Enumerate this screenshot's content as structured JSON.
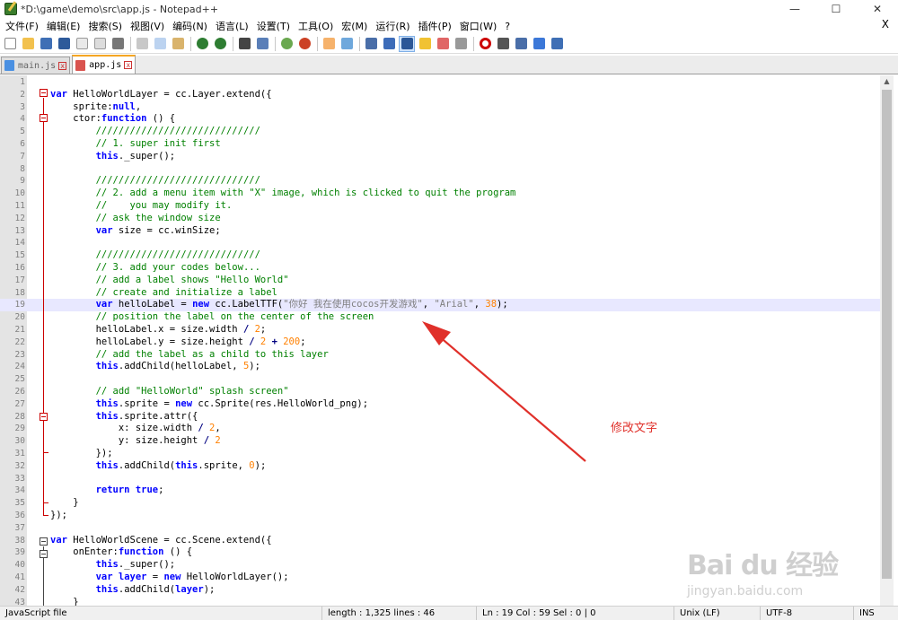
{
  "window": {
    "title": "*D:\\game\\demo\\src\\app.js - Notepad++",
    "minimize": "—",
    "maximize": "☐",
    "close": "✕"
  },
  "menu": {
    "items": [
      "文件(F)",
      "编辑(E)",
      "搜索(S)",
      "视图(V)",
      "编码(N)",
      "语言(L)",
      "设置(T)",
      "工具(O)",
      "宏(M)",
      "运行(R)",
      "插件(P)",
      "窗口(W)",
      "?"
    ],
    "close": "X"
  },
  "toolbar": {
    "icons": [
      "new-file-icon",
      "open-file-icon",
      "save-icon",
      "save-all-icon",
      "close-icon",
      "close-all-icon",
      "print-icon",
      "cut-icon",
      "copy-icon",
      "paste-icon",
      "undo-icon",
      "redo-icon",
      "find-icon",
      "replace-icon",
      "zoom-in-icon",
      "zoom-out-icon",
      "sync-scroll-icon",
      "word-wrap-icon",
      "show-all-chars-icon",
      "indent-guide-icon",
      "doc-map-icon",
      "function-list-icon",
      "folder-workspace-icon",
      "monitor-icon",
      "record-macro-icon",
      "stop-macro-icon",
      "play-macro-icon",
      "run-macro-multiple-icon",
      "save-macro-icon"
    ]
  },
  "tabs": [
    {
      "label": "main.js",
      "active": false,
      "color": "#4a90e2"
    },
    {
      "label": "app.js",
      "active": true,
      "color": "#d9534f"
    }
  ],
  "annotation": "修改文字",
  "watermark": {
    "logo": "Bai du 经验",
    "url": "jingyan.baidu.com"
  },
  "status": {
    "type": "JavaScript file",
    "length": "length : 1,325    lines : 46",
    "position": "Ln : 19    Col : 59    Sel : 0 | 0",
    "eol": "Unix (LF)",
    "encoding": "UTF-8",
    "mode": "INS"
  },
  "code_lines": [
    "",
    "<span class=\"kw\">var</span> HelloWorldLayer = cc.Layer.extend({",
    "    sprite:<span class=\"kw\">null</span>,",
    "    ctor:<span class=\"kw\">function</span> () {",
    "        <span class=\"cm\">/////////////////////////////</span>",
    "        <span class=\"cm\">// 1. super init first</span>",
    "        <span class=\"kw\">this</span>._super();",
    "",
    "        <span class=\"cm\">/////////////////////////////</span>",
    "        <span class=\"cm\">// 2. add a menu item with \"X\" image, which is clicked to quit the program</span>",
    "        <span class=\"cm\">//    you may modify it.</span>",
    "        <span class=\"cm\">// ask the window size</span>",
    "        <span class=\"kw\">var</span> size = cc.winSize;",
    "",
    "        <span class=\"cm\">/////////////////////////////</span>",
    "        <span class=\"cm\">// 3. add your codes below...</span>",
    "        <span class=\"cm\">// add a label shows \"Hello World\"</span>",
    "        <span class=\"cm\">// create and initialize a label</span>",
    "        <span class=\"kw\">var</span> helloLabel = <span class=\"kw\">new</span> cc.LabelTTF(<span class=\"st\">\"你好 我在使用cocos开发游戏\"</span>, <span class=\"st\">\"Arial\"</span>, <span class=\"nm\">38</span>);",
    "        <span class=\"cm\">// position the label on the center of the screen</span>",
    "        helloLabel.x = size.width <span class=\"op\">/</span> <span class=\"nm\">2</span>;",
    "        helloLabel.y = size.height <span class=\"op\">/</span> <span class=\"nm\">2</span> <span class=\"op\">+</span> <span class=\"nm\">200</span>;",
    "        <span class=\"cm\">// add the label as a child to this layer</span>",
    "        <span class=\"kw\">this</span>.addChild(helloLabel, <span class=\"nm\">5</span>);",
    "",
    "        <span class=\"cm\">// add \"HelloWorld\" splash screen\"</span>",
    "        <span class=\"kw\">this</span>.sprite = <span class=\"kw\">new</span> cc.Sprite(res.HelloWorld_png);",
    "        <span class=\"kw\">this</span>.sprite.attr({",
    "            x: size.width <span class=\"op\">/</span> <span class=\"nm\">2</span>,",
    "            y: size.height <span class=\"op\">/</span> <span class=\"nm\">2</span>",
    "        });",
    "        <span class=\"kw\">this</span>.addChild(<span class=\"kw\">this</span>.sprite, <span class=\"nm\">0</span>);",
    "",
    "        <span class=\"kw\">return</span> <span class=\"kw\">true</span>;",
    "    }",
    "});",
    "",
    "<span class=\"kw\">var</span> HelloWorldScene = cc.Scene.extend({",
    "    onEnter:<span class=\"kw\">function</span> () {",
    "        <span class=\"kw\">this</span>._super();",
    "        <span class=\"kw\">var</span> <span class=\"kw\">layer</span> = <span class=\"kw\">new</span> HelloWorldLayer();",
    "        <span class=\"kw\">this</span>.addChild(<span class=\"kw\">layer</span>);",
    "    }"
  ],
  "current_line": 19,
  "accent": "#e0302a"
}
